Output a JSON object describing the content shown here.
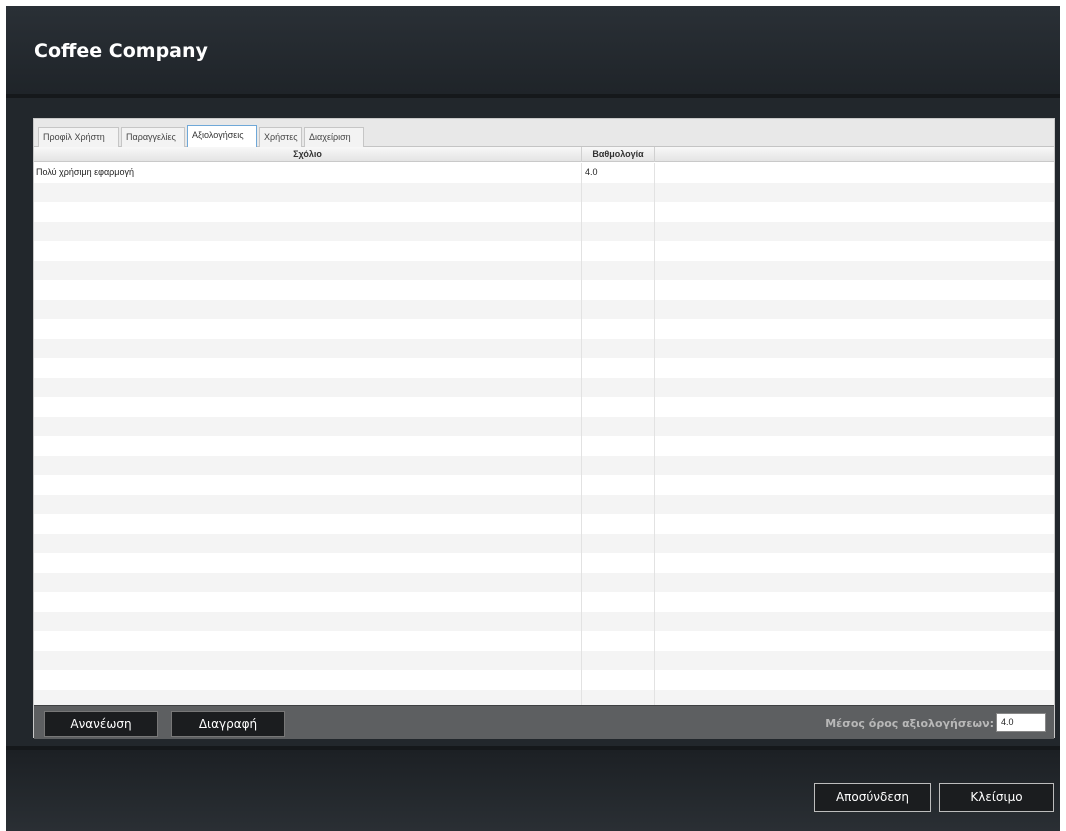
{
  "window": {
    "title": "Coffee Company"
  },
  "tabs": [
    {
      "label": "Προφίλ Χρήστη",
      "active": false
    },
    {
      "label": "Παραγγελίες",
      "active": false
    },
    {
      "label": "Αξιολογήσεις",
      "active": true
    },
    {
      "label": "Χρήστες",
      "active": false
    },
    {
      "label": "Διαχείριση",
      "active": false
    }
  ],
  "table": {
    "columns": [
      "Σχόλιο",
      "Βαθμολογία"
    ],
    "rows": [
      [
        "Πολύ χρήσιμη εφαρμογή",
        "4.0"
      ]
    ]
  },
  "actions": {
    "refresh_label": "Ανανέωση",
    "delete_label": "Διαγραφή",
    "average_label": "Μέσος όρος αξιολογήσεων:",
    "average_value": "4.0"
  },
  "footer": {
    "logout_label": "Αποσύνδεση",
    "close_label": "Κλείσιμο"
  }
}
